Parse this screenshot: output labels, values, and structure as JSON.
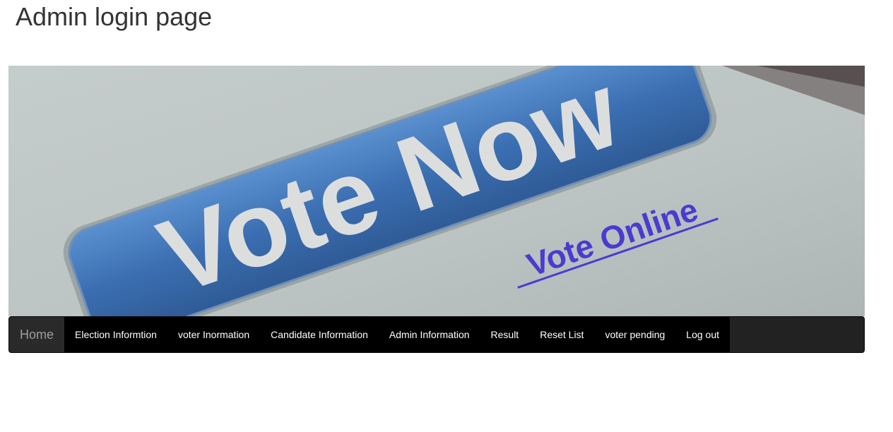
{
  "page": {
    "title": "Admin login page"
  },
  "banner": {
    "image_name": "vote-now-banner",
    "button_text": "Vote Now",
    "link_text": "Vote Online",
    "colors": {
      "button_blue": "#3b6fb2",
      "link_purple": "#4b3bd0"
    }
  },
  "navbar": {
    "colors": {
      "background": "#222222",
      "active": "#2a2a2a"
    },
    "items": [
      {
        "label": "Home",
        "active": true
      },
      {
        "label": "Election Informtion"
      },
      {
        "label": "voter Inormation"
      },
      {
        "label": "Candidate Information"
      },
      {
        "label": "Admin Information"
      },
      {
        "label": "Result"
      },
      {
        "label": "Reset List"
      },
      {
        "label": "voter pending"
      },
      {
        "label": "Log out"
      }
    ]
  }
}
